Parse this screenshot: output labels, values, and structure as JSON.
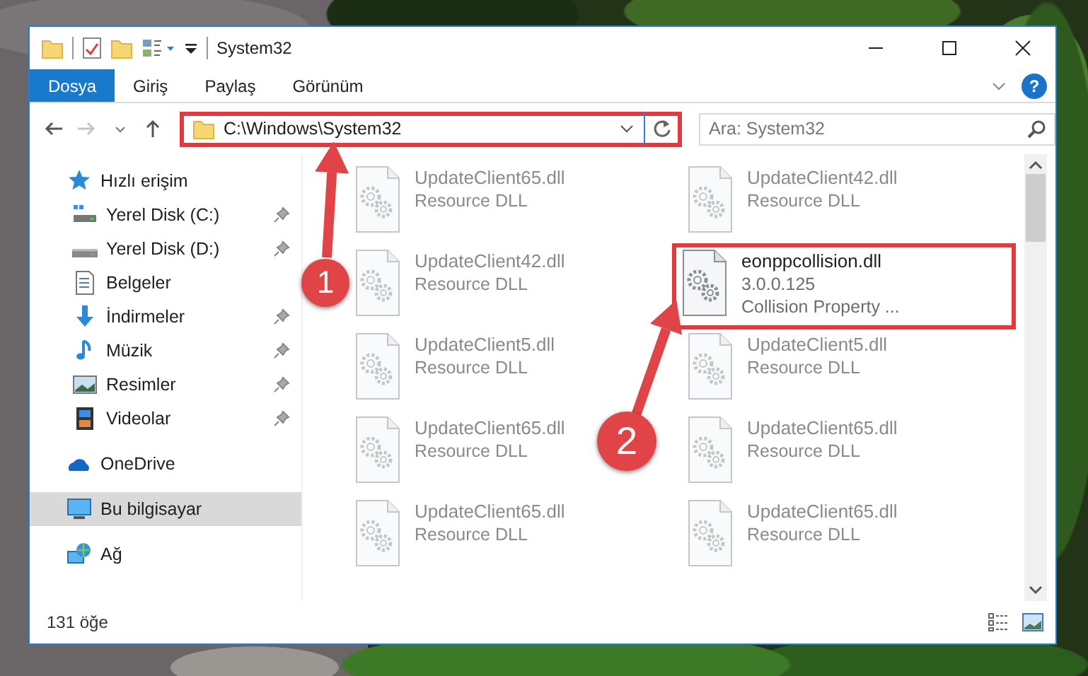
{
  "window": {
    "title": "System32"
  },
  "ribbon": {
    "tabs": [
      {
        "label": "Dosya",
        "selected": true
      },
      {
        "label": "Giriş",
        "selected": false
      },
      {
        "label": "Paylaş",
        "selected": false
      },
      {
        "label": "Görünüm",
        "selected": false
      }
    ],
    "help": "?"
  },
  "address_bar": {
    "path": "C:\\Windows\\System32",
    "highlighted": true
  },
  "search": {
    "placeholder": "Ara: System32"
  },
  "sidebar": {
    "items": [
      {
        "label": "Hızlı erişim",
        "kind": "star",
        "selected": false,
        "children": [
          {
            "label": "Yerel Disk (C:)",
            "kind": "system-drive",
            "selected": false,
            "pinned": true
          },
          {
            "label": "Yerel Disk (D:)",
            "kind": "drive",
            "selected": false,
            "pinned": true
          },
          {
            "label": "Belgeler",
            "kind": "document",
            "selected": false,
            "pinned": false
          },
          {
            "label": "İndirmeler",
            "kind": "download",
            "selected": false,
            "pinned": true
          },
          {
            "label": "Müzik",
            "kind": "music",
            "selected": false,
            "pinned": true
          },
          {
            "label": "Resimler",
            "kind": "pictures",
            "selected": false,
            "pinned": true
          },
          {
            "label": "Videolar",
            "kind": "videos",
            "selected": false,
            "pinned": true
          }
        ]
      },
      {
        "label": "OneDrive",
        "kind": "cloud",
        "selected": false
      },
      {
        "label": "Bu bilgisayar",
        "kind": "computer",
        "selected": true
      },
      {
        "label": "Ağ",
        "kind": "network",
        "selected": false
      }
    ]
  },
  "files": [
    {
      "name": "UpdateClient65.dll",
      "details": [
        "Resource DLL"
      ],
      "blurred": true,
      "highlighted": false
    },
    {
      "name": "UpdateClient42.dll",
      "details": [
        "Resource DLL"
      ],
      "blurred": true,
      "highlighted": false
    },
    {
      "name": "UpdateClient42.dll",
      "details": [
        "Resource DLL"
      ],
      "blurred": true,
      "highlighted": false
    },
    {
      "name": "eonppcollision.dll",
      "details": [
        "3.0.0.125",
        "Collision Property ..."
      ],
      "blurred": false,
      "highlighted": true
    },
    {
      "name": "UpdateClient5.dll",
      "details": [
        "Resource DLL"
      ],
      "blurred": true,
      "highlighted": false
    },
    {
      "name": "UpdateClient5.dll",
      "details": [
        "Resource DLL"
      ],
      "blurred": true,
      "highlighted": false
    },
    {
      "name": "UpdateClient65.dll",
      "details": [
        "Resource DLL"
      ],
      "blurred": true,
      "highlighted": false
    },
    {
      "name": "UpdateClient65.dll",
      "details": [
        "Resource DLL"
      ],
      "blurred": true,
      "highlighted": false
    },
    {
      "name": "UpdateClient65.dll",
      "details": [
        "Resource DLL"
      ],
      "blurred": true,
      "highlighted": false
    },
    {
      "name": "UpdateClient65.dll",
      "details": [
        "Resource DLL"
      ],
      "blurred": true,
      "highlighted": false
    }
  ],
  "status_bar": {
    "count": "131 öğe"
  },
  "callouts": [
    {
      "number": "1"
    },
    {
      "number": "2"
    }
  ]
}
